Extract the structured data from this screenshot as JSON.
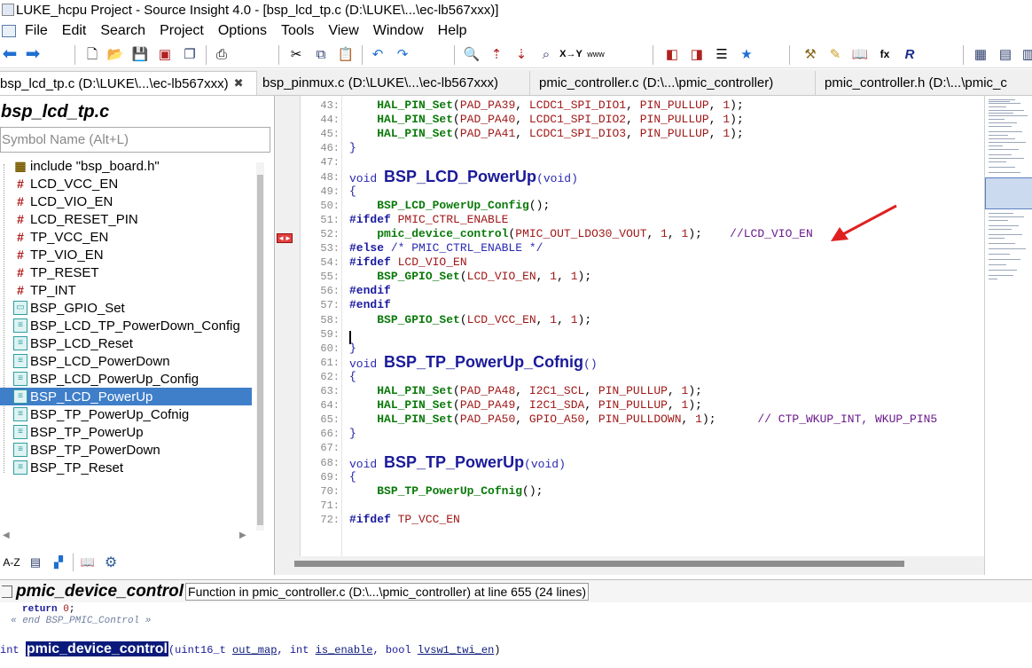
{
  "window": {
    "title": "LUKE_hcpu Project - Source Insight 4.0 - [bsp_lcd_tp.c (D:\\LUKE\\...\\ec-lb567xxx)]"
  },
  "menu": [
    "File",
    "Edit",
    "Search",
    "Project",
    "Options",
    "Tools",
    "View",
    "Window",
    "Help"
  ],
  "tabs": [
    {
      "label": "bsp_lcd_tp.c (D:\\LUKE\\...\\ec-lb567xxx)",
      "close": "✖",
      "active": true
    },
    {
      "label": "bsp_pinmux.c (D:\\LUKE\\...\\ec-lb567xxx)",
      "active": false
    },
    {
      "label": "pmic_controller.c (D:\\...\\pmic_controller)",
      "active": false
    },
    {
      "label": "pmic_controller.h (D:\\...\\pmic_c",
      "active": false
    }
  ],
  "sidebar": {
    "title": "bsp_lcd_tp.c",
    "search_placeholder": "Symbol Name (Alt+L)",
    "symbols": [
      {
        "label": "include \"bsp_board.h\"",
        "icon": "include-icon"
      },
      {
        "label": "LCD_VCC_EN",
        "icon": "define-icon"
      },
      {
        "label": "LCD_VIO_EN",
        "icon": "define-icon"
      },
      {
        "label": "LCD_RESET_PIN",
        "icon": "define-icon"
      },
      {
        "label": "TP_VCC_EN",
        "icon": "define-icon"
      },
      {
        "label": "TP_VIO_EN",
        "icon": "define-icon"
      },
      {
        "label": "TP_RESET",
        "icon": "define-icon"
      },
      {
        "label": "TP_INT",
        "icon": "define-icon"
      },
      {
        "label": "BSP_GPIO_Set",
        "icon": "function-proto-icon"
      },
      {
        "label": "BSP_LCD_TP_PowerDown_Config",
        "icon": "function-icon"
      },
      {
        "label": "BSP_LCD_Reset",
        "icon": "function-icon"
      },
      {
        "label": "BSP_LCD_PowerDown",
        "icon": "function-icon"
      },
      {
        "label": "BSP_LCD_PowerUp_Config",
        "icon": "function-icon"
      },
      {
        "label": "BSP_LCD_PowerUp",
        "icon": "function-icon",
        "selected": true
      },
      {
        "label": "BSP_TP_PowerUp_Cofnig",
        "icon": "function-icon"
      },
      {
        "label": "BSP_TP_PowerUp",
        "icon": "function-icon"
      },
      {
        "label": "BSP_TP_PowerDown",
        "icon": "function-icon"
      },
      {
        "label": "BSP_TP_Reset",
        "icon": "function-icon"
      }
    ],
    "bottom_buttons": [
      "A-Z",
      "list-icon",
      "category-icon",
      "book-icon",
      "gear-icon"
    ]
  },
  "editor": {
    "lines": [
      {
        "n": "43",
        "tokens": [
          [
            "    ",
            ""
          ],
          [
            "HAL_PIN_Set",
            "fc"
          ],
          [
            "(",
            ""
          ],
          [
            "PAD_PA39",
            "mc"
          ],
          [
            ", ",
            ""
          ],
          [
            "LCDC1_SPI_DIO1",
            "mc"
          ],
          [
            ", ",
            ""
          ],
          [
            "PIN_PULLUP",
            "mc"
          ],
          [
            ", ",
            ""
          ],
          [
            "1",
            "nm"
          ],
          [
            ");",
            ""
          ]
        ]
      },
      {
        "n": "44",
        "tokens": [
          [
            "    ",
            ""
          ],
          [
            "HAL_PIN_Set",
            "fc"
          ],
          [
            "(",
            ""
          ],
          [
            "PAD_PA40",
            "mc"
          ],
          [
            ", ",
            ""
          ],
          [
            "LCDC1_SPI_DIO2",
            "mc"
          ],
          [
            ", ",
            ""
          ],
          [
            "PIN_PULLUP",
            "mc"
          ],
          [
            ", ",
            ""
          ],
          [
            "1",
            "nm"
          ],
          [
            ");",
            ""
          ]
        ]
      },
      {
        "n": "45",
        "tokens": [
          [
            "    ",
            ""
          ],
          [
            "HAL_PIN_Set",
            "fc"
          ],
          [
            "(",
            ""
          ],
          [
            "PAD_PA41",
            "mc"
          ],
          [
            ", ",
            ""
          ],
          [
            "LCDC1_SPI_DIO3",
            "mc"
          ],
          [
            ", ",
            ""
          ],
          [
            "PIN_PULLUP",
            "mc"
          ],
          [
            ", ",
            ""
          ],
          [
            "1",
            "nm"
          ],
          [
            ");",
            ""
          ]
        ]
      },
      {
        "n": "46",
        "tokens": [
          [
            "}",
            "par"
          ]
        ]
      },
      {
        "n": "47",
        "tokens": []
      },
      {
        "n": "48",
        "tokens": [
          [
            "void ",
            "kw"
          ],
          [
            "BSP_LCD_PowerUp",
            "big"
          ],
          [
            "(void)",
            "kw"
          ]
        ]
      },
      {
        "n": "49",
        "tokens": [
          [
            "{",
            "par"
          ]
        ]
      },
      {
        "n": "50",
        "tokens": [
          [
            "    ",
            ""
          ],
          [
            "BSP_LCD_PowerUp_Config",
            "fc"
          ],
          [
            "();",
            ""
          ]
        ]
      },
      {
        "n": "51",
        "tokens": [
          [
            "#ifdef ",
            "pp"
          ],
          [
            "PMIC_CTRL_ENABLE",
            "mc"
          ]
        ]
      },
      {
        "n": "52",
        "tokens": [
          [
            "    ",
            ""
          ],
          [
            "pmic_device_control",
            "fc"
          ],
          [
            "(",
            ""
          ],
          [
            "PMIC_OUT_LDO30_VOUT",
            "mc"
          ],
          [
            ", ",
            ""
          ],
          [
            "1",
            "nm"
          ],
          [
            ", ",
            ""
          ],
          [
            "1",
            "nm"
          ],
          [
            ");",
            ""
          ],
          [
            "    //LCD_VIO_EN",
            "cmnt"
          ]
        ]
      },
      {
        "n": "53",
        "tokens": [
          [
            "#else ",
            "pp"
          ],
          [
            "/* PMIC_CTRL_ENABLE */",
            "cm"
          ]
        ]
      },
      {
        "n": "54",
        "tokens": [
          [
            "#ifdef ",
            "pp"
          ],
          [
            "LCD_VIO_EN",
            "mc"
          ]
        ]
      },
      {
        "n": "55",
        "tokens": [
          [
            "    ",
            ""
          ],
          [
            "BSP_GPIO_Set",
            "fc"
          ],
          [
            "(",
            ""
          ],
          [
            "LCD_VIO_EN",
            "mc"
          ],
          [
            ", ",
            ""
          ],
          [
            "1",
            "nm"
          ],
          [
            ", ",
            ""
          ],
          [
            "1",
            "nm"
          ],
          [
            ");",
            ""
          ]
        ]
      },
      {
        "n": "56",
        "tokens": [
          [
            "#endif",
            "pp"
          ]
        ]
      },
      {
        "n": "57",
        "tokens": [
          [
            "#endif",
            "pp"
          ]
        ]
      },
      {
        "n": "58",
        "tokens": [
          [
            "    ",
            ""
          ],
          [
            "BSP_GPIO_Set",
            "fc"
          ],
          [
            "(",
            ""
          ],
          [
            "LCD_VCC_EN",
            "mc"
          ],
          [
            ", ",
            ""
          ],
          [
            "1",
            "nm"
          ],
          [
            ", ",
            ""
          ],
          [
            "1",
            "nm"
          ],
          [
            ");",
            ""
          ]
        ]
      },
      {
        "n": "59",
        "tokens": []
      },
      {
        "n": "60",
        "tokens": [
          [
            "}",
            "par"
          ]
        ]
      },
      {
        "n": "61",
        "tokens": [
          [
            "void ",
            "kw"
          ],
          [
            "BSP_TP_PowerUp_Cofnig",
            "big"
          ],
          [
            "()",
            "kw"
          ]
        ]
      },
      {
        "n": "62",
        "tokens": [
          [
            "{",
            "par"
          ]
        ]
      },
      {
        "n": "63",
        "tokens": [
          [
            "    ",
            ""
          ],
          [
            "HAL_PIN_Set",
            "fc"
          ],
          [
            "(",
            ""
          ],
          [
            "PAD_PA48",
            "mc"
          ],
          [
            ", ",
            ""
          ],
          [
            "I2C1_SCL",
            "mc"
          ],
          [
            ", ",
            ""
          ],
          [
            "PIN_PULLUP",
            "mc"
          ],
          [
            ", ",
            ""
          ],
          [
            "1",
            "nm"
          ],
          [
            ");",
            ""
          ]
        ]
      },
      {
        "n": "64",
        "tokens": [
          [
            "    ",
            ""
          ],
          [
            "HAL_PIN_Set",
            "fc"
          ],
          [
            "(",
            ""
          ],
          [
            "PAD_PA49",
            "mc"
          ],
          [
            ", ",
            ""
          ],
          [
            "I2C1_SDA",
            "mc"
          ],
          [
            ", ",
            ""
          ],
          [
            "PIN_PULLUP",
            "mc"
          ],
          [
            ", ",
            ""
          ],
          [
            "1",
            "nm"
          ],
          [
            ");",
            ""
          ]
        ]
      },
      {
        "n": "65",
        "tokens": [
          [
            "    ",
            ""
          ],
          [
            "HAL_PIN_Set",
            "fc"
          ],
          [
            "(",
            ""
          ],
          [
            "PAD_PA50",
            "mc"
          ],
          [
            ", ",
            ""
          ],
          [
            "GPIO_A50",
            "mc"
          ],
          [
            ", ",
            ""
          ],
          [
            "PIN_PULLDOWN",
            "mc"
          ],
          [
            ", ",
            ""
          ],
          [
            "1",
            "nm"
          ],
          [
            ");",
            ""
          ],
          [
            "      // CTP_WKUP_INT, WKUP_PIN5",
            "cmnt"
          ]
        ]
      },
      {
        "n": "66",
        "tokens": [
          [
            "}",
            "par"
          ]
        ]
      },
      {
        "n": "67",
        "tokens": []
      },
      {
        "n": "68",
        "tokens": [
          [
            "void ",
            "kw"
          ],
          [
            "BSP_TP_PowerUp",
            "big"
          ],
          [
            "(void)",
            "kw"
          ]
        ]
      },
      {
        "n": "69",
        "tokens": [
          [
            "{",
            "par"
          ]
        ]
      },
      {
        "n": "70",
        "tokens": [
          [
            "    ",
            ""
          ],
          [
            "BSP_TP_PowerUp_Cofnig",
            "fc"
          ],
          [
            "();",
            ""
          ]
        ]
      },
      {
        "n": "71",
        "tokens": []
      },
      {
        "n": "72",
        "tokens": [
          [
            "#ifdef ",
            "pp"
          ],
          [
            "TP_VCC_EN",
            "mc"
          ]
        ]
      }
    ]
  },
  "context": {
    "symbol": "pmic_device_control",
    "info": "Function in pmic_controller.c (D:\\...\\pmic_controller) at line 655 (24 lines)",
    "line1_kw": "return ",
    "line1_val": "0",
    "line1_end": ";",
    "line2": "« end BSP_PMIC_Control »",
    "sig_type": "int ",
    "sig_name": "pmic_device_control",
    "sig_p1_type": "(uint16_t ",
    "sig_p1": "out_map",
    "sig_p2_type": ", int ",
    "sig_p2": "is_enable",
    "sig_p3_type": ", bool ",
    "sig_p3": "lvsw1_twi_en",
    "sig_end": ")"
  },
  "colors": {
    "accent": "#3f7ec9",
    "selection": "#0a1a7a",
    "arrow": "#e02020"
  }
}
